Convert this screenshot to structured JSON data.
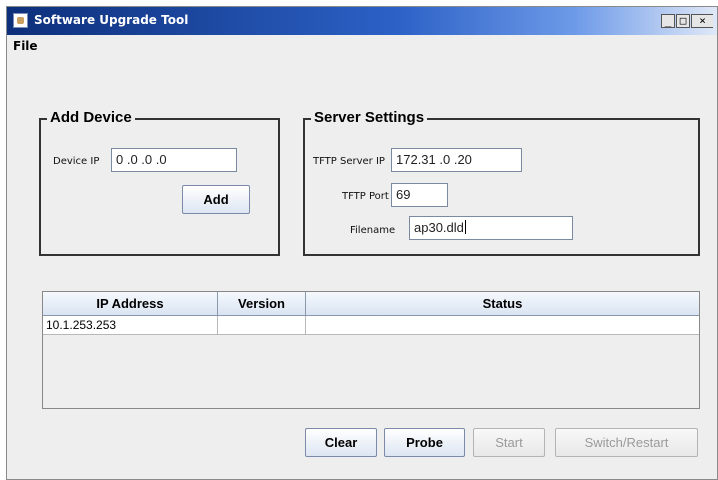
{
  "window": {
    "title": "Software Upgrade Tool",
    "controls": {
      "minimize": "_",
      "maximize": "□",
      "close": "×"
    }
  },
  "menu": {
    "items": [
      {
        "label": "File"
      }
    ]
  },
  "add_device": {
    "title": "Add Device",
    "device_ip_label": "Device IP",
    "device_ip_value": "0 .0 .0 .0",
    "add_button": "Add"
  },
  "server_settings": {
    "title": "Server Settings",
    "tftp_server_ip_label": "TFTP Server IP",
    "tftp_server_ip_value": "172.31 .0 .20",
    "tftp_port_label": "TFTP Port",
    "tftp_port_value": "69",
    "filename_label": "Filename",
    "filename_value": "ap30.dld"
  },
  "devices_table": {
    "columns": [
      "IP Address",
      "Version",
      "Status"
    ],
    "rows": [
      {
        "ip_address": "10.1.253.253",
        "version": "",
        "status": ""
      }
    ]
  },
  "actions": {
    "clear": "Clear",
    "probe": "Probe",
    "start": "Start",
    "switch_restart": "Switch/Restart"
  }
}
